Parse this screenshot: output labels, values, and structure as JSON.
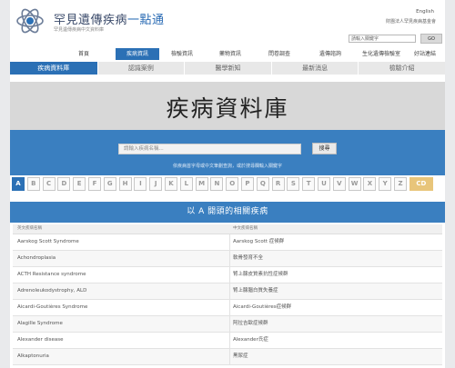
{
  "header": {
    "title_main": "罕見遺傳疾病",
    "title_accent": "一點通",
    "subtitle": "罕見遺傳疾病中文資料庫",
    "lang_link": "English",
    "org_link": "財團法人罕見疾病基金會",
    "search_placeholder": "請輸入關鍵字",
    "search_button": "GO"
  },
  "nav": {
    "items": [
      "首頁",
      "疾病資訊",
      "檢驗資訊",
      "藥物資訊",
      "問卷調查",
      "遺傳諮詢",
      "生化遺傳檢驗室",
      "好站連結"
    ],
    "active_index": 1
  },
  "subnav": {
    "items": [
      "疾病資料庫",
      "認識案例",
      "醫學新知",
      "最新消息",
      "檢驗介紹"
    ],
    "active_index": 0
  },
  "hero": {
    "title": "疾病資料庫"
  },
  "search": {
    "placeholder": "請輸入疾病名稱...",
    "button": "搜尋",
    "hint": "依疾病首字母或中文筆劃查詢，或於搜尋欄輸入關鍵字"
  },
  "letters": {
    "items": [
      "A",
      "B",
      "C",
      "D",
      "E",
      "F",
      "G",
      "H",
      "I",
      "J",
      "K",
      "L",
      "M",
      "N",
      "O",
      "P",
      "Q",
      "R",
      "S",
      "T",
      "U",
      "V",
      "W",
      "X",
      "Y",
      "Z",
      "CD"
    ],
    "active_index": 0
  },
  "results": {
    "title": "以 A 開頭的相關疾病",
    "col_en": "英文疾病名稱",
    "col_zh": "中文疾病名稱",
    "rows": [
      {
        "en": "Aarskog Scott Syndrome",
        "zh": "Aarskog Scott 症候群"
      },
      {
        "en": "Achondroplasia",
        "zh": "軟骨發育不全"
      },
      {
        "en": "ACTH Resistance syndrome",
        "zh": "腎上腺皮質素抗性症候群"
      },
      {
        "en": "Adrenoleukodystrophy, ALD",
        "zh": "腎上腺腦白質失養症"
      },
      {
        "en": "Aicardi-Goutières Syndrome",
        "zh": "Aicardi-Goutières症候群"
      },
      {
        "en": "Alagille Syndrome",
        "zh": "阿拉吉歐症候群"
      },
      {
        "en": "Alexander disease",
        "zh": "Alexander氏症"
      },
      {
        "en": "Alkaptonuria",
        "zh": "黑尿症"
      }
    ]
  },
  "colors": {
    "accent": "#2b70b5",
    "band": "#3a7fc0",
    "cd_badge": "#e8c57a"
  }
}
